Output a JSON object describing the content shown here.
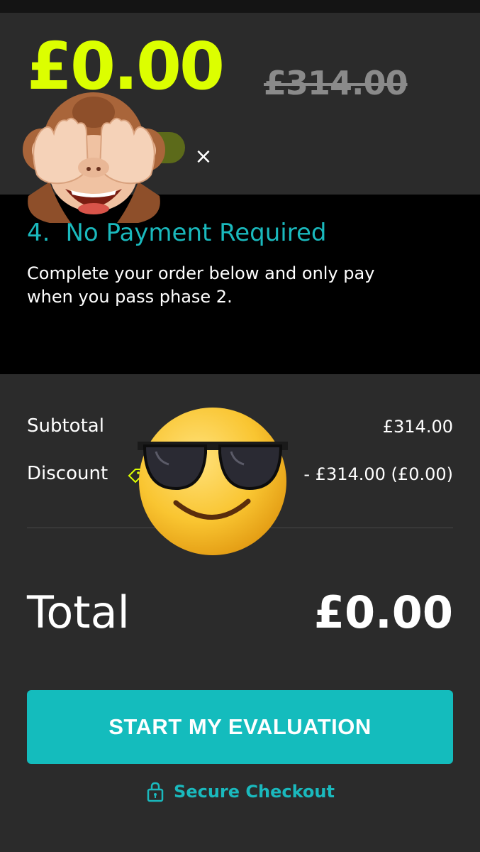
{
  "pricing": {
    "current_price": "£0.00",
    "original_price": "£314.00",
    "coupon_close_symbol": "×"
  },
  "step": {
    "number": "4.",
    "title": "No Payment Required",
    "description": "Complete your order below and only pay when you pass phase 2."
  },
  "summary": {
    "subtotal_label": "Subtotal",
    "subtotal_value": "£314.00",
    "discount_label": "Discount",
    "discount_value": "- £314.00  (£0.00)",
    "total_label": "Total",
    "total_value": "£0.00"
  },
  "actions": {
    "cta_label": "START MY EVALUATION",
    "secure_label": "Secure Checkout"
  },
  "icons": {
    "monkey": "see-no-evil-monkey-emoji",
    "sunglasses": "smiling-face-with-sunglasses-emoji",
    "lock": "lock-icon",
    "tag": "tag-icon",
    "close": "close-icon"
  },
  "colors": {
    "accent_lime": "#dcff00",
    "accent_teal": "#14bcbd",
    "background": "#2b2b2b",
    "panel": "#000000"
  }
}
